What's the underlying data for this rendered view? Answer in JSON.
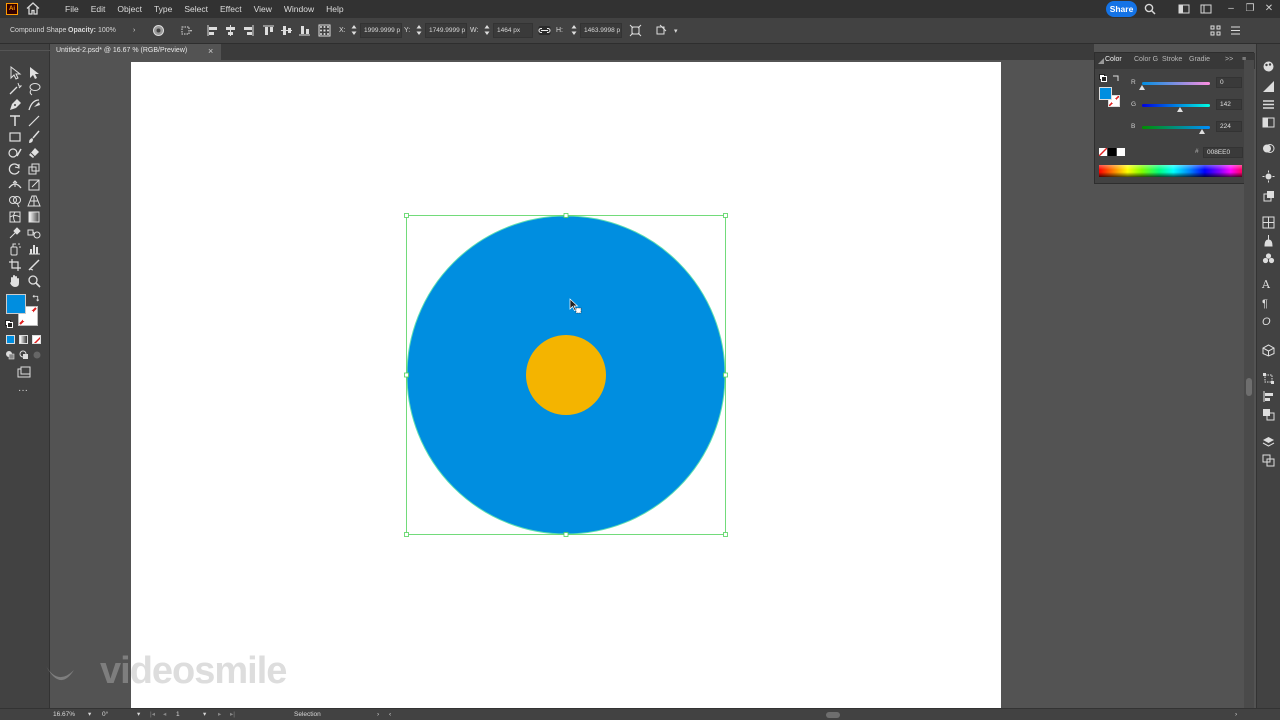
{
  "app": {
    "logo_text": "Ai"
  },
  "menubar": {
    "items": [
      "File",
      "Edit",
      "Object",
      "Type",
      "Select",
      "Effect",
      "View",
      "Window",
      "Help"
    ],
    "share_label": "Share"
  },
  "controlbar": {
    "selection_type": "Compound Shape",
    "opacity_label": "Opacity:",
    "opacity_value": "100%",
    "x_label": "X:",
    "x_value": "1999.9999 p",
    "y_label": "Y:",
    "y_value": "1749.9999 p",
    "w_label": "W:",
    "w_value": "1464 px",
    "h_label": "H:",
    "h_value": "1463.9998 p"
  },
  "document": {
    "tab_title": "Untitled-2.psd* @ 16.67 % (RGB/Preview)",
    "close_glyph": "×"
  },
  "color_panel": {
    "tabs": [
      "Color",
      "Color G",
      "Stroke",
      "Gradie"
    ],
    "r_label": "R",
    "g_label": "G",
    "b_label": "B",
    "r_value": "0",
    "g_value": "142",
    "b_value": "224",
    "r_fraction": 0,
    "g_fraction": 0.557,
    "b_fraction": 0.878,
    "hex_label": "#",
    "hex_value": "008EE0"
  },
  "colors": {
    "fill": "#008ee0",
    "inner_circle": "#f4b400",
    "selection": "#4fd35a",
    "accent": "#1473e6"
  },
  "statusbar": {
    "zoom": "16.67%",
    "rotation": "0°",
    "artboard_number": "1",
    "tool_name": "Selection"
  },
  "watermark": {
    "text": "videosmile"
  }
}
